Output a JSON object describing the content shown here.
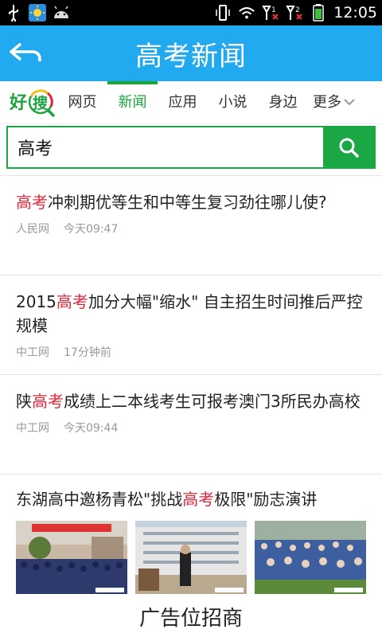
{
  "status_bar": {
    "time": "12:05",
    "icons": [
      "usb-icon",
      "weather-icon",
      "android-icon",
      "vibrate-icon",
      "wifi-icon",
      "signal-1-icon",
      "signal-2-icon",
      "battery-icon"
    ]
  },
  "header": {
    "title": "高考新闻"
  },
  "tabs": {
    "logo_text": "好搜",
    "items": [
      {
        "label": "网页"
      },
      {
        "label": "新闻"
      },
      {
        "label": "应用"
      },
      {
        "label": "小说"
      },
      {
        "label": "身边"
      }
    ],
    "active_index": 1,
    "more_label": "更多"
  },
  "search": {
    "value": "高考"
  },
  "news": [
    {
      "pre": "",
      "keyword": "高考",
      "post": "冲刺期优等生和中等生复习劲往哪儿使?",
      "source": "人民网",
      "time": "今天09:47"
    },
    {
      "pre": "2015",
      "keyword": "高考",
      "post": "加分大幅\"缩水\" 自主招生时间推后严控规模",
      "source": "中工网",
      "time": "17分钟前"
    },
    {
      "pre": "陕",
      "keyword": "高考",
      "post": "成绩上二本线考生可报考澳门3所民办高校",
      "source": "中工网",
      "time": "今天09:44"
    }
  ],
  "ad": {
    "pre": "东湖高中邀杨青松\"挑战",
    "keyword": "高考",
    "post": "极限\"励志演讲",
    "label": "广告位招商"
  },
  "colors": {
    "accent_blue": "#22aaf0",
    "accent_green": "#1ba744",
    "highlight_red": "#e0263b"
  }
}
